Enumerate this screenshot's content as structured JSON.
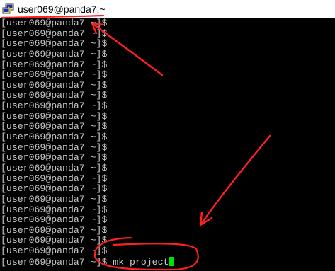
{
  "window": {
    "title": "user069@panda7:~",
    "icon": "putty-terminal-icon"
  },
  "terminal": {
    "prompt_lines": [
      "[user069@panda7 ~]$",
      "[user069@panda7 ~]$",
      "[user069@panda7 ~]$",
      "[user069@panda7 ~]$",
      "[user069@panda7 ~]$",
      "[user069@panda7 ~]$",
      "[user069@panda7 ~]$",
      "[user069@panda7 ~]$",
      "[user069@panda7 ~]$",
      "[user069@panda7 ~]$",
      "[user069@panda7 ~]$",
      "[user069@panda7 ~]$",
      "[user069@panda7 ~]$",
      "[user069@panda7 ~]$",
      "[user069@panda7 ~]$",
      "[user069@panda7 ~]$",
      "[user069@panda7 ~]$",
      "[user069@panda7 ~]$",
      "[user069@panda7 ~]$",
      "[user069@panda7 ~]$",
      "[user069@panda7 ~]$",
      "[user069@panda7 ~]$",
      "[user069@panda7 ~]$"
    ],
    "current_prompt": "[user069@panda7 ~]$",
    "current_input": " mk project",
    "text_color": "#c8c8c8",
    "background_color": "#000000",
    "cursor_color": "#00e000"
  },
  "annotations": {
    "color": "#ff2020",
    "items": [
      "title-underline",
      "arrow-to-top-line",
      "arrow-to-input",
      "input-circle"
    ]
  }
}
